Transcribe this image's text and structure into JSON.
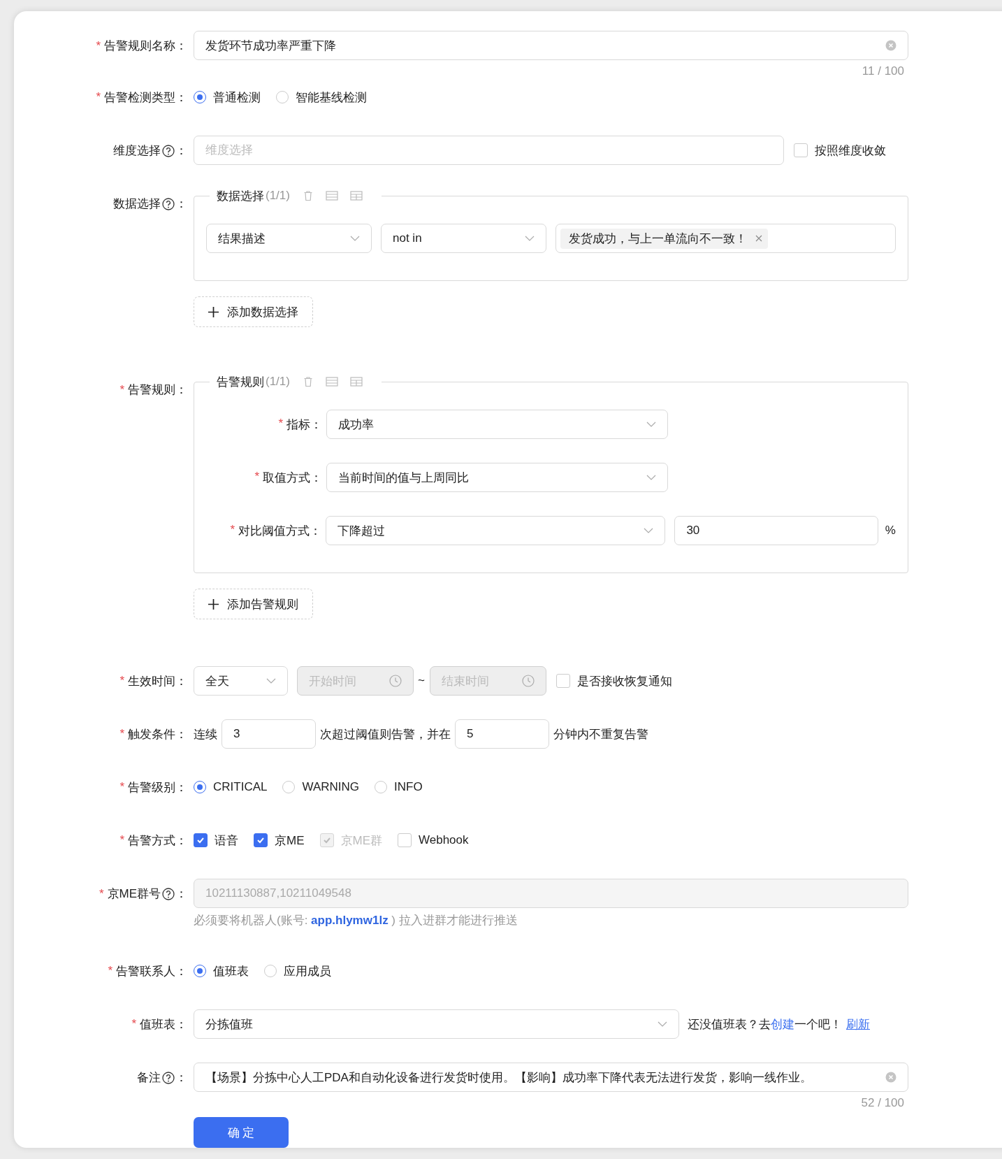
{
  "rule_name": {
    "mark": "*",
    "label": "告警规则名称：",
    "value": "发货环节成功率严重下降",
    "count": "11 / 100"
  },
  "detect_type": {
    "mark": "*",
    "label": "告警检测类型：",
    "options": [
      {
        "label": "普通检测",
        "selected": true
      },
      {
        "label": "智能基线检测",
        "selected": false
      }
    ]
  },
  "dimension": {
    "label": "维度选择",
    "help": true,
    "colon": "：",
    "placeholder": "维度选择",
    "converge": {
      "label": "按照维度收敛",
      "checked": false
    }
  },
  "data_select": {
    "label": "数据选择",
    "help": true,
    "colon": "：",
    "group_title": "数据选择",
    "group_count": "(1/1)",
    "conditions": [
      {
        "field": "结果描述",
        "operator": "not in",
        "tags": [
          "发货成功，与上一单流向不一致！"
        ]
      }
    ],
    "add_button": "添加数据选择"
  },
  "alert_rule": {
    "mark": "*",
    "label": "告警规则：",
    "group_title": "告警规则",
    "group_count": "(1/1)",
    "metric": {
      "mark": "*",
      "label": "指标：",
      "value": "成功率"
    },
    "value_mode": {
      "mark": "*",
      "label": "取值方式：",
      "value": "当前时间的值与上周同比"
    },
    "threshold_mode": {
      "mark": "*",
      "label": "对比阈值方式：",
      "value": "下降超过",
      "threshold": "30",
      "unit": "%"
    },
    "add_button": "添加告警规则"
  },
  "effective_time": {
    "mark": "*",
    "label": "生效时间：",
    "period": "全天",
    "start_placeholder": "开始时间",
    "separator": "~",
    "end_placeholder": "结束时间",
    "time_disabled": true,
    "recovery": {
      "label": "是否接收恢复通知",
      "checked": false
    }
  },
  "trigger": {
    "mark": "*",
    "label": "触发条件：",
    "prefix": "连续",
    "count": "3",
    "middle": "次超过阈值则告警，并在",
    "minutes": "5",
    "suffix": "分钟内不重复告警"
  },
  "level": {
    "mark": "*",
    "label": "告警级别：",
    "options": [
      {
        "label": "CRITICAL",
        "selected": true
      },
      {
        "label": "WARNING",
        "selected": false
      },
      {
        "label": "INFO",
        "selected": false
      }
    ]
  },
  "methods": {
    "mark": "*",
    "label": "告警方式：",
    "options": [
      {
        "label": "语音",
        "checked": true,
        "disabled": false
      },
      {
        "label": "京ME",
        "checked": true,
        "disabled": false
      },
      {
        "label": "京ME群",
        "checked": true,
        "disabled": true
      },
      {
        "label": "Webhook",
        "checked": false,
        "disabled": false
      }
    ]
  },
  "group_number": {
    "mark": "*",
    "label": "京ME群号",
    "help": true,
    "colon": "：",
    "value": "10211130887,10211049548",
    "disabled": true,
    "hint": "必须要将机器人(账号: **app.hlymw1lz** ) 拉入进群才能进行推送"
  },
  "contact": {
    "mark": "*",
    "label": "告警联系人：",
    "options": [
      {
        "label": "值班表",
        "selected": true
      },
      {
        "label": "应用成员",
        "selected": false
      }
    ]
  },
  "duty": {
    "mark": "*",
    "label": "值班表：",
    "value": "分拣值班",
    "note_before": "还没值班表？去",
    "create_link": "创建",
    "note_after": "一个吧！",
    "refresh_link": "刷新"
  },
  "remark": {
    "label": "备注",
    "help": true,
    "colon": "：",
    "value": "【场景】分拣中心人工PDA和自动化设备进行发货时使用。【影响】成功率下降代表无法进行发货，影响一线作业。",
    "count": "52 / 100"
  },
  "submit": "确 定"
}
